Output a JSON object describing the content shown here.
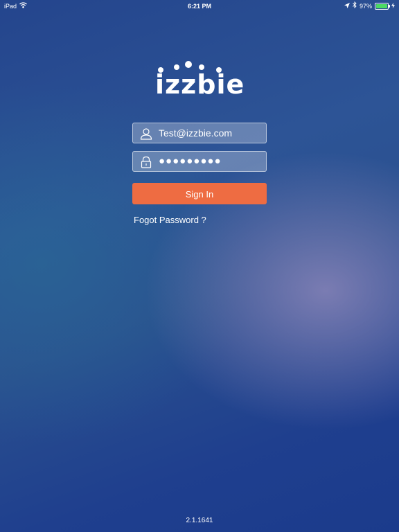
{
  "statusbar": {
    "device": "iPad",
    "time": "6:21 PM",
    "battery": "97%",
    "battery_level": 0.97,
    "battery_color": "#4cd964"
  },
  "logo": {
    "text": "izzbie"
  },
  "login": {
    "email_value": "Test@izzbie.com",
    "password_value": "●●●●●●●●●",
    "email_icon": "user-icon",
    "password_icon": "lock-icon",
    "sign_in_label": "Sign In",
    "forgot_label": "Fogot Password ?",
    "accent": "#ee6c42"
  },
  "version": "2.1.1641"
}
